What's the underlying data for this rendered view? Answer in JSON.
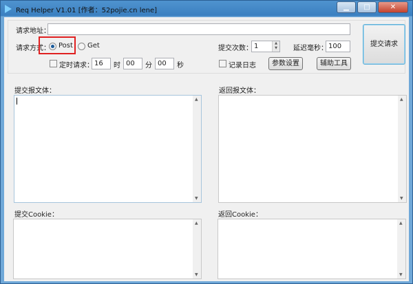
{
  "window": {
    "title": "Req Helper V1.01    [作者：52pojie.cn lene]",
    "minimize": "▁",
    "maximize": "□",
    "close": "✕"
  },
  "request": {
    "url_label": "请求地址：",
    "url_value": "",
    "method_label": "请求方式：",
    "method_options": [
      "Post",
      "Get"
    ],
    "method_selected": "Post",
    "count_label": "提交次数：",
    "count_value": "1",
    "delay_label": "延迟毫秒：",
    "delay_value": "100",
    "timer_label": "定时请求：",
    "timer_checked": false,
    "hour_value": "16",
    "hour_unit": "时",
    "minute_value": "00",
    "minute_unit": "分",
    "second_value": "00",
    "second_unit": "秒",
    "log_label": "记录日志",
    "log_checked": false,
    "params_button": "参数设置",
    "tools_button": "辅助工具",
    "submit_button": "提交请求"
  },
  "panels": {
    "submit_body_label": "提交报文体：",
    "response_body_label": "返回报文体：",
    "submit_cookie_label": "提交Cookie：",
    "response_cookie_label": "返回Cookie："
  }
}
